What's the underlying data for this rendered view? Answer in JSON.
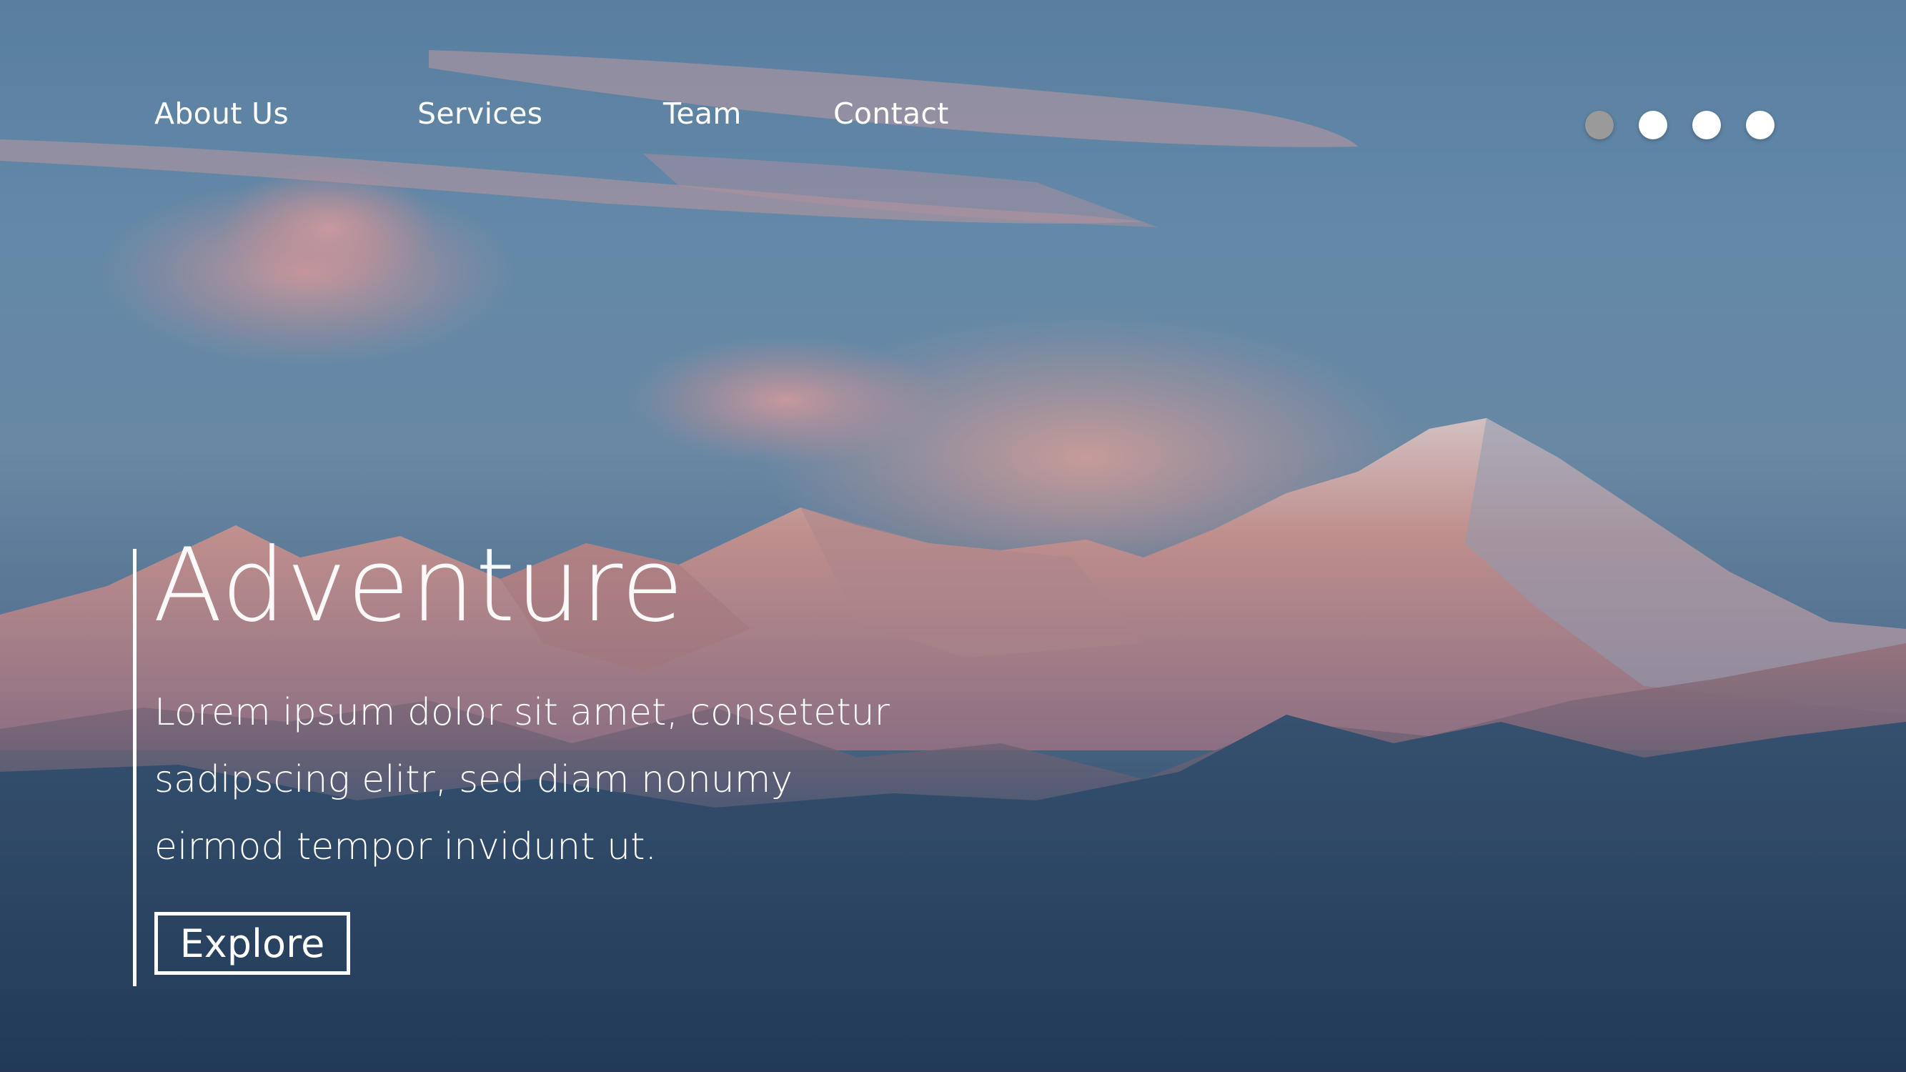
{
  "nav": {
    "items": [
      {
        "label": "About Us"
      },
      {
        "label": "Services"
      },
      {
        "label": "Team"
      },
      {
        "label": "Contact"
      }
    ]
  },
  "slider": {
    "count": 4,
    "active_index": 0
  },
  "hero": {
    "title": "Adventure",
    "body_lines": [
      "Lorem ipsum dolor sit amet, consetetur",
      "sadipscing elitr, sed diam nonumy",
      "eirmod tempor invidunt ut."
    ],
    "cta_label": "Explore",
    "image": "mountain-landscape-photo"
  },
  "colors": {
    "text": "#ffffff",
    "dot_active": "#9a9a9a",
    "dot_inactive": "#ffffff",
    "sky": "#6a8fae",
    "foreground": "#1d3452"
  }
}
